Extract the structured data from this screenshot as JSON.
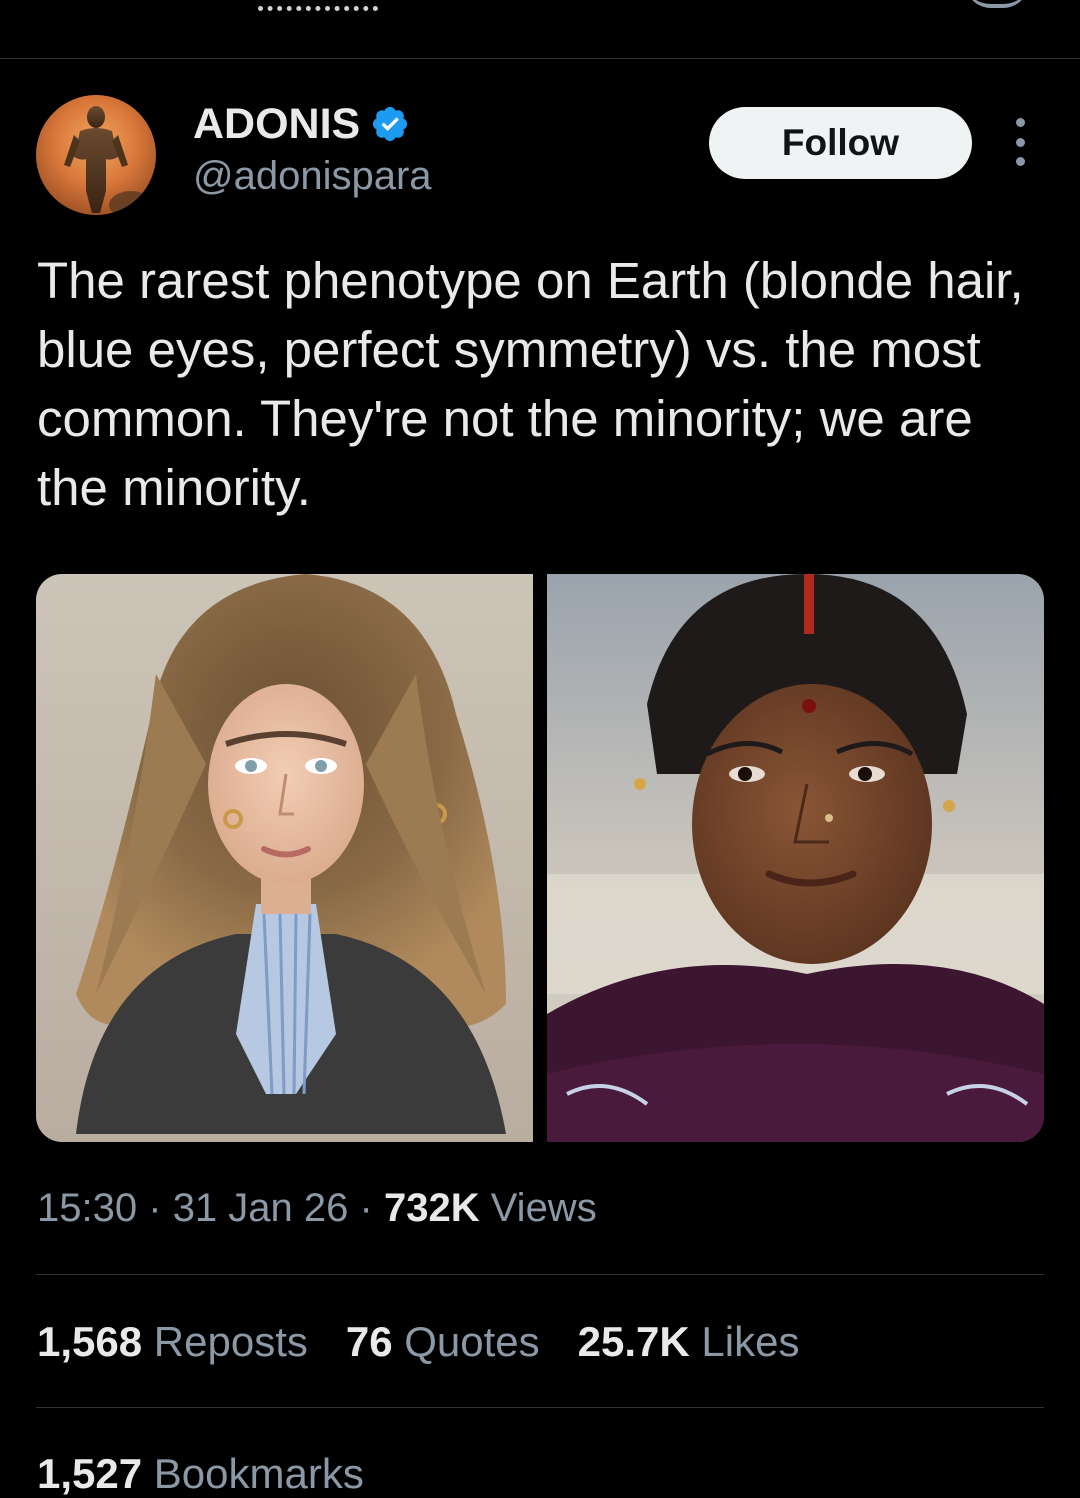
{
  "author": {
    "display_name": "ADONIS",
    "handle": "@adonispara",
    "verified": true
  },
  "follow_label": "Follow",
  "tweet": {
    "text": "The rarest phenotype on Earth (blonde hair, blue eyes, perfect symmetry) vs. the most common. They're not the minority; we are the minority."
  },
  "meta": {
    "time": "15:30",
    "separator": "·",
    "date": "31 Jan 26",
    "views_count": "732K",
    "views_label": "Views"
  },
  "stats": [
    {
      "count": "1,568",
      "label": "Reposts"
    },
    {
      "count": "76",
      "label": "Quotes"
    },
    {
      "count": "25.7K",
      "label": "Likes"
    }
  ],
  "bookmarks": {
    "count": "1,527",
    "label": "Bookmarks"
  },
  "icons": {
    "verified": "verified-badge-icon",
    "more": "more-vertical-icon"
  },
  "colors": {
    "background": "#000000",
    "primary_text": "#e7e9ea",
    "secondary_text": "#8b98a5",
    "verified_blue": "#1d9bf0",
    "follow_bg": "#eff3f4",
    "divider": "#2f3336"
  }
}
